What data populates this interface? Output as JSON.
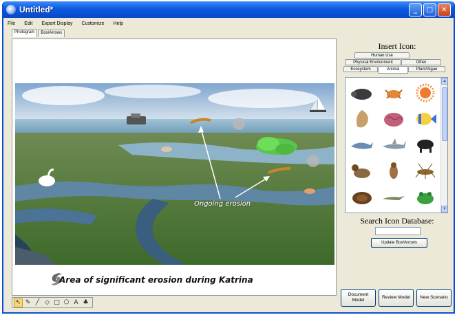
{
  "window": {
    "title": "Untitled*"
  },
  "menu": [
    "File",
    "Edit",
    "Export Display",
    "Customize",
    "Help"
  ],
  "view_tabs": [
    "Photogram",
    "Box/Arrows"
  ],
  "canvas": {
    "erosion_label": "Ongoing erosion",
    "legend_caption": "Area of significant erosion during Katrina"
  },
  "toolbar_icons": [
    "pointer-tool",
    "pencil-tool",
    "line-tool",
    "diamond-tool",
    "rectangle-tool",
    "pentagon-tool",
    "text-tool",
    "fill-tool"
  ],
  "side": {
    "insert_title": "Insert Icon:",
    "tabs_row1": [
      "Human Use"
    ],
    "tabs_row2": [
      "Physical Environment",
      "Other"
    ],
    "tabs_row3": [
      "Ecosystem",
      "Animal",
      "Plant/Algae"
    ],
    "active_tab": "Animal",
    "icons": [
      "armadillo-icon",
      "crab-icon",
      "anemone-icon",
      "shell-icon",
      "brain-coral-icon",
      "tropical-fish-icon",
      "dolphin-icon",
      "shark-icon",
      "cow-icon",
      "duck-icon",
      "bird-icon",
      "insect-icon",
      "snake-icon",
      "lizard-icon",
      "frog-icon",
      "mammal-icon",
      "turtle-icon",
      "cattle-icon"
    ],
    "search_title": "Search Icon Database:",
    "search_value": "",
    "update_button": "Update Box/Arrows",
    "buttons": [
      "Document Model",
      "Review Model",
      "New Scenario"
    ]
  },
  "colors": {
    "titlebar": "#0a5ae0",
    "accent": "#0a4fd1"
  }
}
